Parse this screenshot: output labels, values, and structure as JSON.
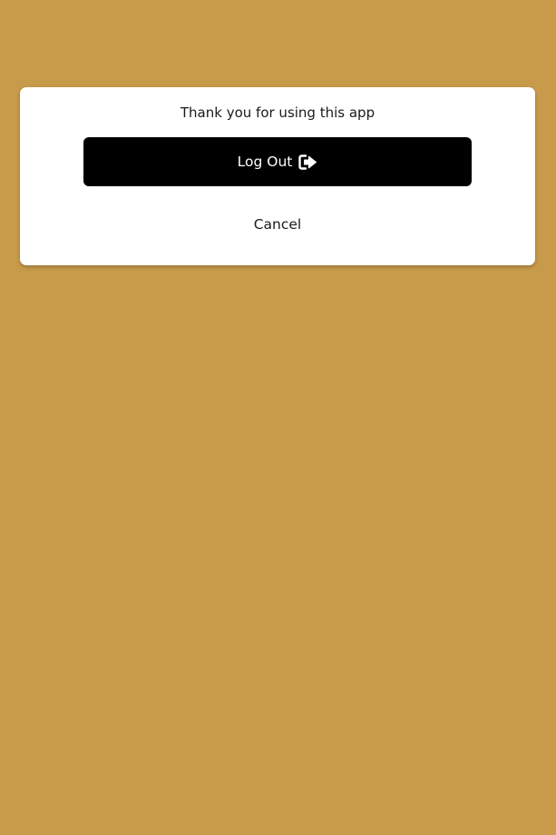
{
  "modal": {
    "message": "Thank you for using this app",
    "logout_label": "Log Out",
    "logout_icon": "sign-out-icon",
    "cancel_label": "Cancel"
  },
  "colors": {
    "background": "#c89b4b",
    "modal_bg": "#ffffff",
    "primary_button_bg": "#000000",
    "primary_button_text": "#ffffff",
    "text": "#1a1a1a"
  }
}
